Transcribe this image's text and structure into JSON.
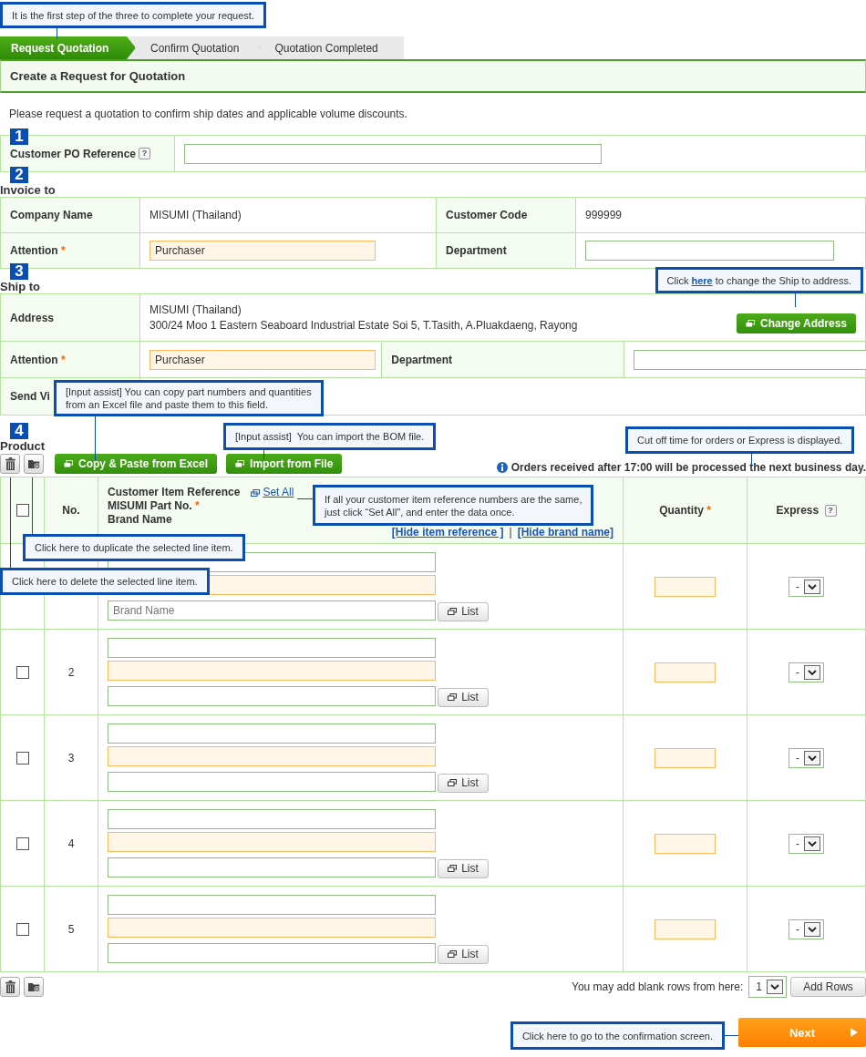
{
  "steps": [
    {
      "label": "Request Quotation",
      "selected": true
    },
    {
      "label": "Confirm Quotation",
      "selected": false
    },
    {
      "label": "Quotation Completed",
      "selected": false
    }
  ],
  "page_title": "Create a Request for Quotation",
  "intro": "Please request a quotation to confirm ship dates and applicable volume discounts.",
  "po": {
    "number": "1",
    "label": "Customer PO Reference",
    "help": "?"
  },
  "invoice": {
    "number": "2",
    "heading": "Invoice to",
    "company_label": "Company Name",
    "company": "MISUMI (Thailand)",
    "code_label": "Customer Code",
    "code": "999999",
    "attention_label": "Attention",
    "required": "*",
    "attention": "Purchaser",
    "department_label": "Department"
  },
  "ship": {
    "number": "3",
    "heading": "Ship to",
    "address_label": "Address",
    "address_lines": [
      "MISUMI (Thailand)",
      "300/24 Moo 1 Eastern Seaboard Industrial Estate Soi 5, T.Tasith, A.Pluakdaeng, Rayong"
    ],
    "change_button": "Change Address",
    "attention_label": "Attention",
    "required": "*",
    "attention": "Purchaser",
    "department_label": "Department",
    "send_via_label": "Send Vi"
  },
  "product": {
    "number": "4",
    "heading": "Product",
    "excel_button": "Copy & Paste from Excel",
    "import_button": "Import from File",
    "notice": "Orders received after 17:00 will be processed the next business day.",
    "select_all": {
      "checked": false
    },
    "columns": {
      "no": "No.",
      "ref": "Customer Item Reference",
      "set_all": "Set All",
      "part": "MISUMI Part No.",
      "part_required": "*",
      "brand": "Brand Name",
      "hide_ref": "[Hide item reference ]",
      "separator": "|",
      "hide_brand": "[Hide brand name]",
      "quantity": "Quantity",
      "quantity_required": "*",
      "express": "Express",
      "help": "?"
    },
    "rows": [
      {
        "brand_placeholder": "Brand Name",
        "list_button": "List",
        "express": "-"
      },
      {
        "no": "2",
        "checked": false,
        "list_button": "List",
        "express": "-"
      },
      {
        "no": "3",
        "checked": false,
        "list_button": "List",
        "express": "-"
      },
      {
        "no": "4",
        "checked": false,
        "list_button": "List",
        "express": "-"
      },
      {
        "no": "5",
        "checked": false,
        "list_button": "List",
        "express": "-"
      }
    ]
  },
  "add_rows": {
    "label": "You may add blank rows from here:",
    "count": "1",
    "button": "Add Rows"
  },
  "next_button": "Next",
  "callouts": [
    {
      "kind": "step",
      "text": "It is the first step of the three to complete your request."
    },
    {
      "kind": "address",
      "text": "Click ",
      "link": "here",
      "after": " to change the Ship to address."
    },
    {
      "kind": "excel",
      "text": "[Input assist] You can copy part numbers and quantities\nfrom an Excel file and paste them to this field."
    },
    {
      "kind": "bom",
      "text": "[Input assist]  You can import the BOM file."
    },
    {
      "kind": "cutoff",
      "text": "Cut off time for orders or Express is displayed."
    },
    {
      "kind": "setall",
      "text": "If all your customer item reference numbers are the same,\njust click “Set All”, and enter the data once."
    },
    {
      "kind": "duplicate",
      "text": "Click here to duplicate the selected line item."
    },
    {
      "kind": "delete",
      "text": "Click here to delete the selected line item."
    },
    {
      "kind": "next",
      "text": "Click here to go to the confirmation screen."
    }
  ]
}
